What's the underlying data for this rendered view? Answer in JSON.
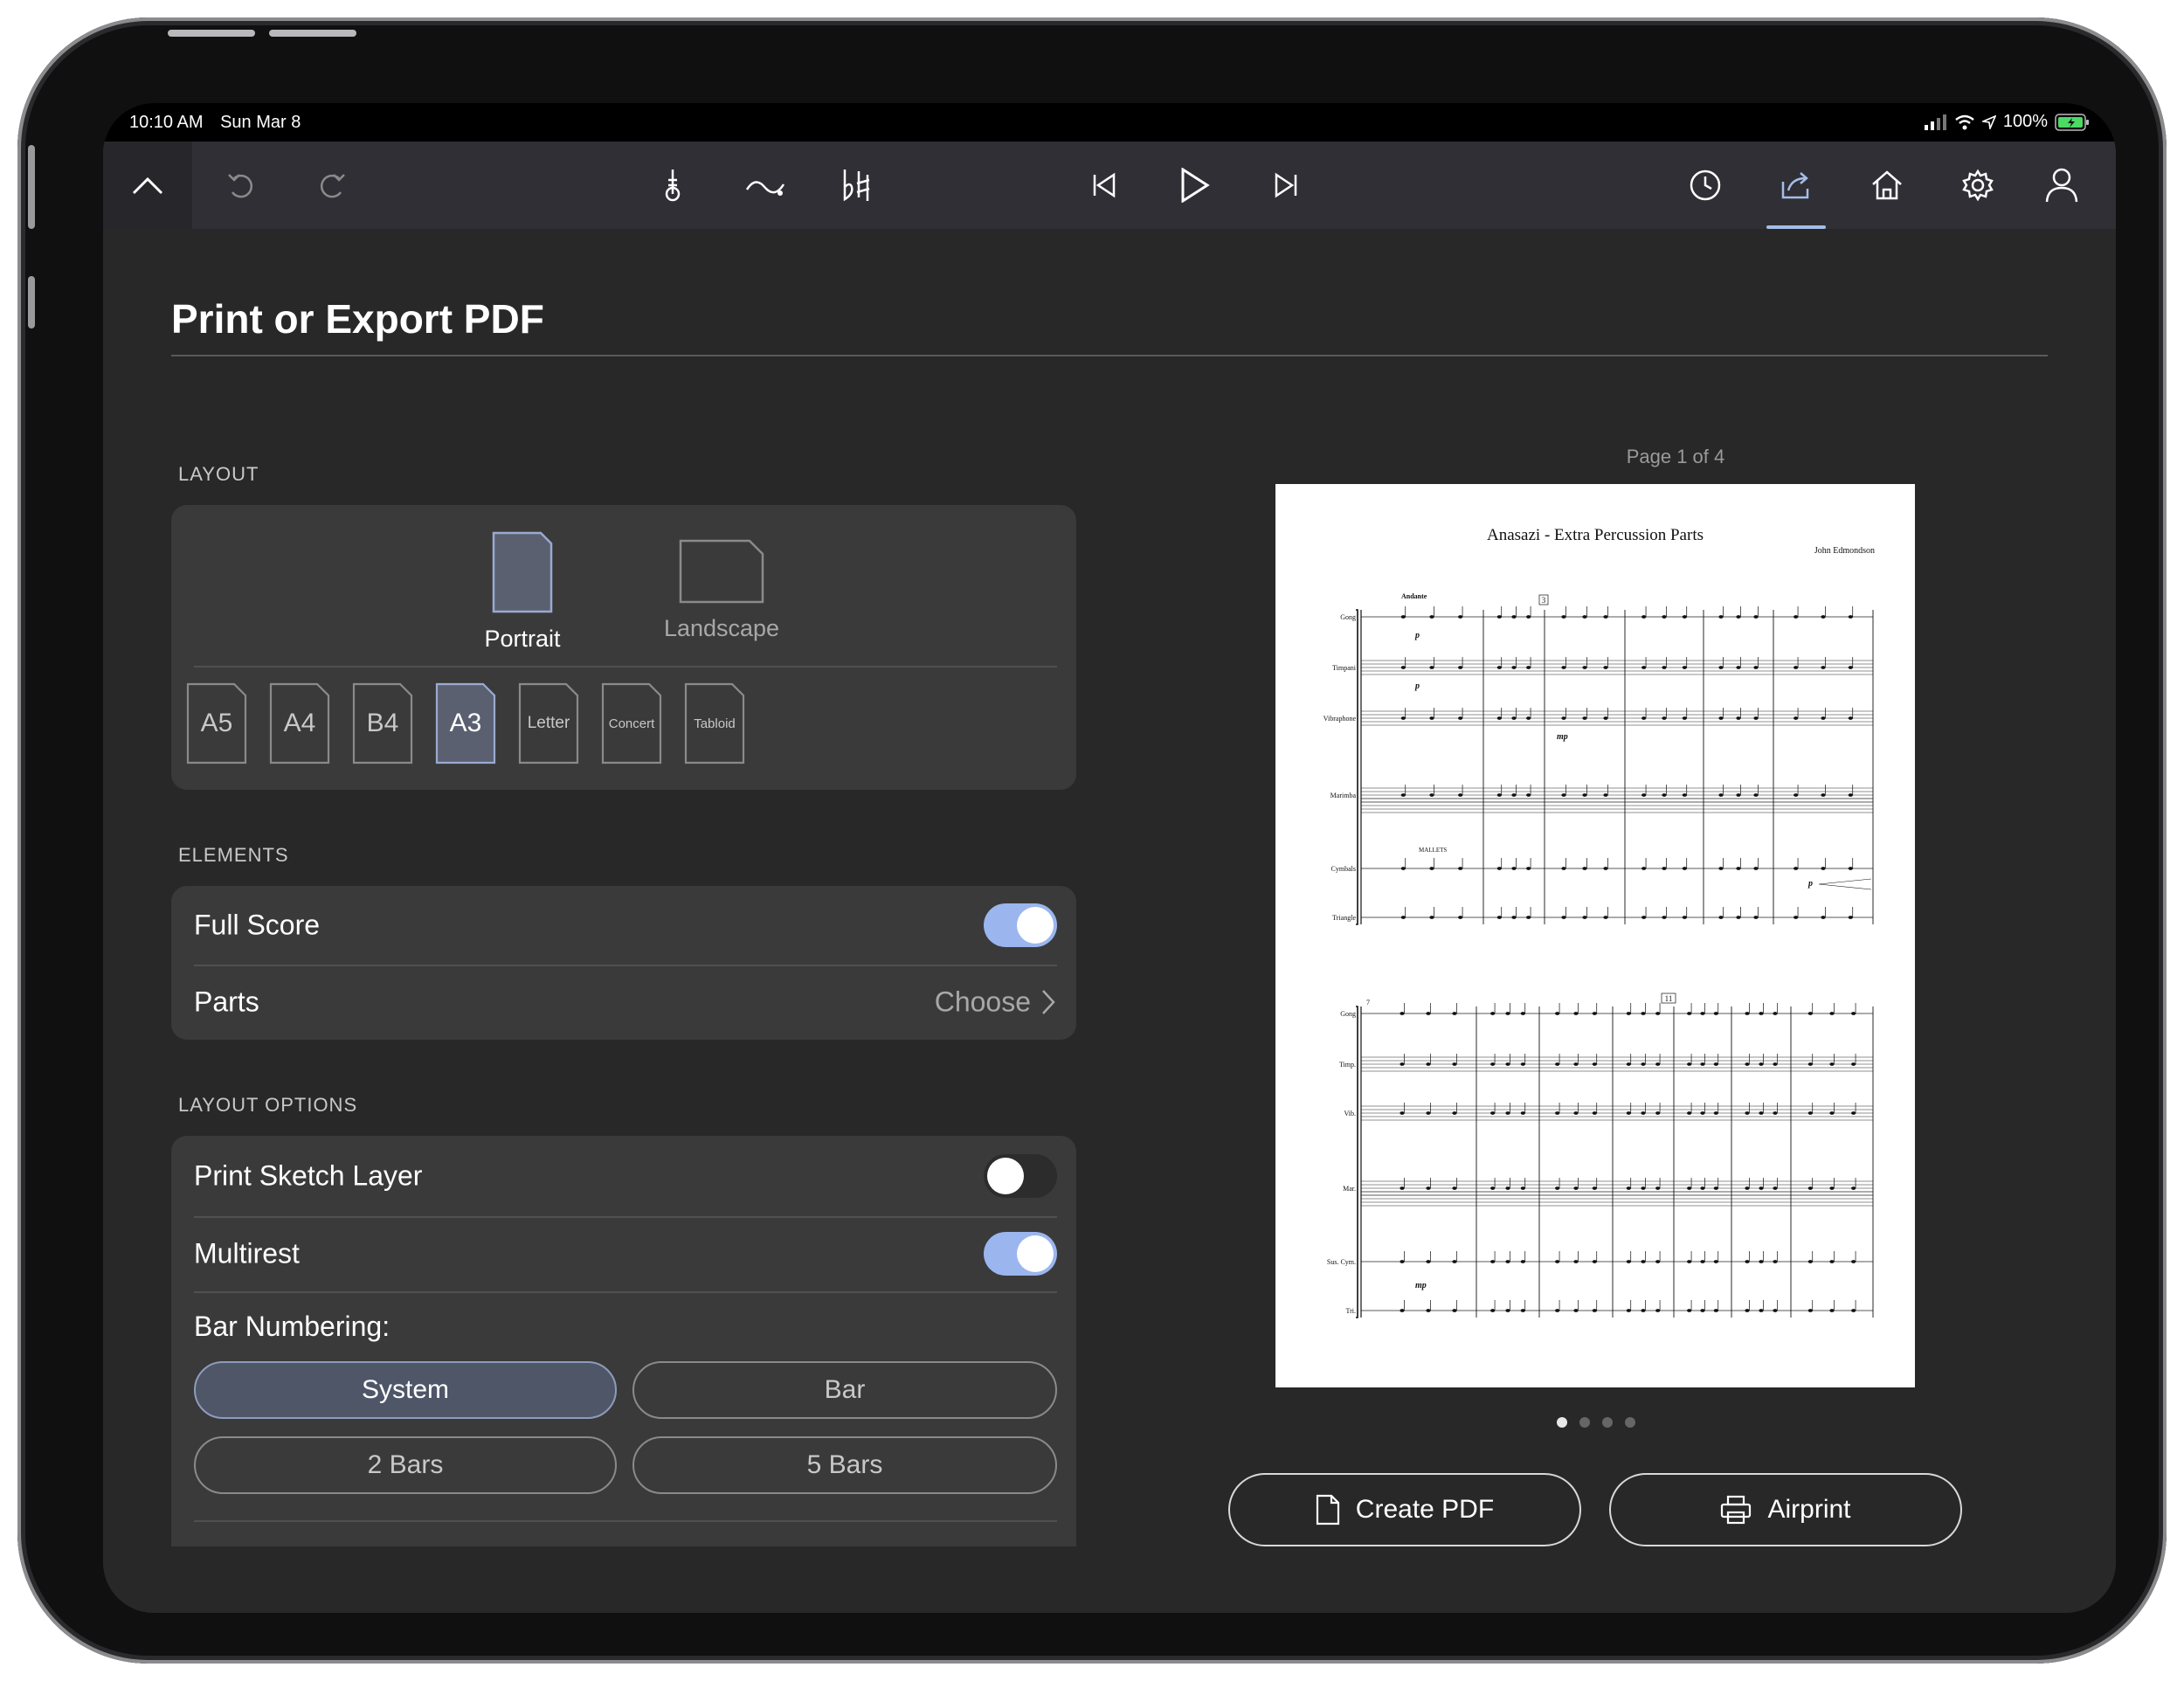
{
  "status_bar": {
    "time": "10:10 AM",
    "date": "Sun Mar 8",
    "battery": "100%"
  },
  "toolbar": {
    "icons": [
      "chevron-up-icon",
      "undo-icon",
      "redo-icon",
      "metronome-icon",
      "tie-icon",
      "accidentals-icon",
      "skip-back-icon",
      "play-icon",
      "skip-forward-icon",
      "history-icon",
      "share-icon",
      "home-icon",
      "gear-icon",
      "account-icon"
    ],
    "active_tab": "share"
  },
  "page": {
    "title": "Print or Export PDF"
  },
  "layout": {
    "section_label": "LAYOUT",
    "orientation": {
      "portrait": "Portrait",
      "landscape": "Landscape",
      "selected": "Portrait"
    },
    "paper_sizes": [
      {
        "label": "A5",
        "selected": false
      },
      {
        "label": "A4",
        "selected": false
      },
      {
        "label": "B4",
        "selected": false
      },
      {
        "label": "A3",
        "selected": true
      },
      {
        "label": "Letter",
        "selected": false
      },
      {
        "label": "Concert",
        "selected": false
      },
      {
        "label": "Tabloid",
        "selected": false
      }
    ]
  },
  "elements": {
    "section_label": "ELEMENTS",
    "full_score": {
      "label": "Full Score",
      "on": true
    },
    "parts": {
      "label": "Parts",
      "value": "Choose"
    }
  },
  "layout_options": {
    "section_label": "LAYOUT OPTIONS",
    "print_sketch_layer": {
      "label": "Print Sketch Layer",
      "on": false
    },
    "multirest": {
      "label": "Multirest",
      "on": true
    },
    "bar_numbering": {
      "label": "Bar Numbering:",
      "options": [
        "System",
        "Bar",
        "2 Bars",
        "5 Bars"
      ],
      "selected": "System"
    }
  },
  "preview": {
    "page_indicator": "Page 1 of 4",
    "pages": 4,
    "current_page": 1,
    "score": {
      "title": "Anasazi - Extra Percussion Parts",
      "composer": "John Edmondson",
      "tempo": "Andante",
      "rehearsal_marks": [
        "3",
        "11"
      ],
      "system1_instruments": [
        "Gong",
        "Timpani",
        "Vibraphone",
        "Marimba",
        "Cymbals",
        "Triangle"
      ],
      "system2_instruments": [
        "Gong",
        "Timp.",
        "Vib.",
        "Mar.",
        "Sus. Cym.",
        "Tri."
      ],
      "dynamics": [
        "p",
        "p",
        "mp",
        "p",
        "mp"
      ],
      "mallets": "MALLETS",
      "system2_number": "7"
    }
  },
  "actions": {
    "create_pdf": "Create PDF",
    "airprint": "Airprint"
  },
  "colors": {
    "accent": "#9bb6ee",
    "screen_bg": "#282828",
    "card_bg": "#3a3a3a",
    "toolbar_bg": "#2f2f35"
  }
}
